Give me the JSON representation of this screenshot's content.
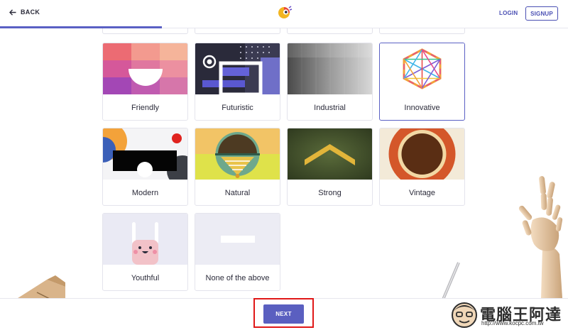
{
  "header": {
    "back_label": "BACK",
    "login_label": "LOGIN",
    "signup_label": "SIGNUP",
    "progress_fraction": 0.285
  },
  "styles": {
    "title": "",
    "selected": "Innovative",
    "options": [
      {
        "label": "Friendly",
        "icon": "friendly-thumbnail"
      },
      {
        "label": "Futuristic",
        "icon": "futuristic-thumbnail"
      },
      {
        "label": "Industrial",
        "icon": "industrial-thumbnail"
      },
      {
        "label": "Innovative",
        "icon": "innovative-thumbnail"
      },
      {
        "label": "Modern",
        "icon": "modern-thumbnail"
      },
      {
        "label": "Natural",
        "icon": "natural-thumbnail"
      },
      {
        "label": "Strong",
        "icon": "strong-thumbnail"
      },
      {
        "label": "Vintage",
        "icon": "vintage-thumbnail"
      },
      {
        "label": "Youthful",
        "icon": "youthful-thumbnail"
      },
      {
        "label": "None of the above",
        "icon": "none-thumbnail"
      }
    ]
  },
  "footer": {
    "next_label": "NEXT"
  },
  "watermark": {
    "text": "電腦王阿達",
    "url": "http://www.kocpc.com.tw"
  },
  "colors": {
    "accent": "#5a5fc0",
    "highlight_box": "#e01818"
  }
}
